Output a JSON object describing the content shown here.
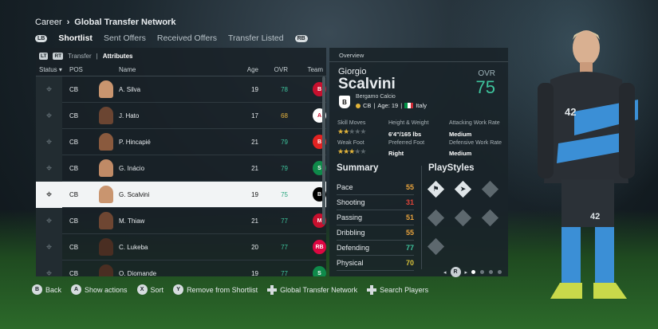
{
  "breadcrumb": {
    "root": "Career",
    "current": "Global Transfer Network"
  },
  "tabs": {
    "left_button": "LB",
    "right_button": "RB",
    "items": [
      {
        "label": "Shortlist",
        "active": true
      },
      {
        "label": "Sent Offers",
        "active": false
      },
      {
        "label": "Received Offers",
        "active": false
      },
      {
        "label": "Transfer Listed",
        "active": false
      }
    ]
  },
  "list": {
    "subtab_left_button": "LT",
    "subtab_right_button": "RT",
    "subtabs": [
      "Transfer",
      "Attributes"
    ],
    "columns": {
      "status": "Status ▾",
      "pos": "POS",
      "name": "Name",
      "age": "Age",
      "ovr": "OVR",
      "team": "Team"
    },
    "rows": [
      {
        "pos": "CB",
        "name": "A. Silva",
        "age": "19",
        "ovr": "78",
        "ovr_color": "#3ec49d",
        "crest_color": "#c8102e",
        "crest_text": "B",
        "skin": "#c9956f"
      },
      {
        "pos": "CB",
        "name": "J. Hato",
        "age": "17",
        "ovr": "68",
        "ovr_color": "#e7b33d",
        "crest_color": "#ffffff",
        "crest_text": "A",
        "skin": "#6b4532"
      },
      {
        "pos": "CB",
        "name": "P. Hincapié",
        "age": "21",
        "ovr": "79",
        "ovr_color": "#3ec49d",
        "crest_color": "#e32221",
        "crest_text": "B",
        "skin": "#8a5a3e"
      },
      {
        "pos": "CB",
        "name": "G. Inácio",
        "age": "21",
        "ovr": "79",
        "ovr_color": "#3ec49d",
        "crest_color": "#0f8a4a",
        "crest_text": "S",
        "skin": "#c08a66"
      },
      {
        "pos": "CB",
        "name": "G. Scalvini",
        "age": "19",
        "ovr": "75",
        "ovr_color": "#2aa57e",
        "crest_color": "#000000",
        "crest_text": "B",
        "skin": "#c9956f",
        "selected": true
      },
      {
        "pos": "CB",
        "name": "M. Thiaw",
        "age": "21",
        "ovr": "77",
        "ovr_color": "#3ec49d",
        "crest_color": "#c8102e",
        "crest_text": "M",
        "skin": "#6e4632"
      },
      {
        "pos": "CB",
        "name": "C. Lukeba",
        "age": "20",
        "ovr": "77",
        "ovr_color": "#3ec49d",
        "crest_color": "#dd0741",
        "crest_text": "RB",
        "skin": "#4a2e22"
      },
      {
        "pos": "CB",
        "name": "O. Diomande",
        "age": "19",
        "ovr": "77",
        "ovr_color": "#3ec49d",
        "crest_color": "#0f8a4a",
        "crest_text": "S",
        "skin": "#4a2e22"
      }
    ]
  },
  "overview": {
    "header": "Overview",
    "first_name": "Giorgio",
    "last_name": "Scalvini",
    "ovr_label": "OVR",
    "ovr": "75",
    "club": "Bergamo Calcio",
    "position": "CB",
    "age_text": "Age: 19",
    "nation": "Italy",
    "skill_moves_label": "Skill Moves",
    "skill_moves_stars": 2,
    "weak_foot_label": "Weak Foot",
    "weak_foot_stars": 3,
    "height_weight_label": "Height & Weight",
    "height_weight": "6'4\"/165 lbs",
    "preferred_foot_label": "Preferred Foot",
    "preferred_foot": "Right",
    "attacking_wr_label": "Attacking Work Rate",
    "attacking_wr": "Medium",
    "defensive_wr_label": "Defensive Work Rate",
    "defensive_wr": "Medium",
    "summary_title": "Summary",
    "summary": [
      {
        "label": "Pace",
        "value": "55",
        "color": "#e7a23d"
      },
      {
        "label": "Shooting",
        "value": "31",
        "color": "#e0453a"
      },
      {
        "label": "Passing",
        "value": "51",
        "color": "#e7a23d"
      },
      {
        "label": "Dribbling",
        "value": "55",
        "color": "#e7a23d"
      },
      {
        "label": "Defending",
        "value": "77",
        "color": "#3ec49d"
      },
      {
        "label": "Physical",
        "value": "70",
        "color": "#d8c23a"
      }
    ],
    "playstyles_title": "PlayStyles",
    "pager_button": "R",
    "pages": 4,
    "active_page": 0
  },
  "footer": [
    {
      "key": "B",
      "label": "Back"
    },
    {
      "key": "A",
      "label": "Show actions"
    },
    {
      "key": "X",
      "label": "Sort"
    },
    {
      "key": "Y",
      "label": "Remove from Shortlist"
    },
    {
      "key": "dpad",
      "label": "Global Transfer Network"
    },
    {
      "key": "dpad",
      "label": "Search Players"
    }
  ],
  "colors": {
    "accent_green": "#3ec49d",
    "kit_blue": "#3b8fd6"
  }
}
